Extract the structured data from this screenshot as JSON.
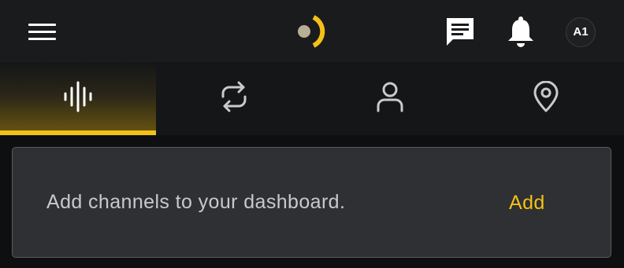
{
  "header": {
    "menu_icon": "hamburger-menu-icon",
    "logo_icon": "brand-logo",
    "messages_icon": "chat-icon",
    "notifications_icon": "bell-icon",
    "avatar_initials": "A1",
    "accent_color": "#f3c117",
    "logo_dot_color": "#b8ad96"
  },
  "tabs": [
    {
      "icon": "sound-waves-icon",
      "active": true
    },
    {
      "icon": "sync-arrows-icon",
      "active": false
    },
    {
      "icon": "person-icon",
      "active": false
    },
    {
      "icon": "location-pin-icon",
      "active": false
    }
  ],
  "card": {
    "message": "Add channels to your dashboard.",
    "action_label": "Add"
  }
}
